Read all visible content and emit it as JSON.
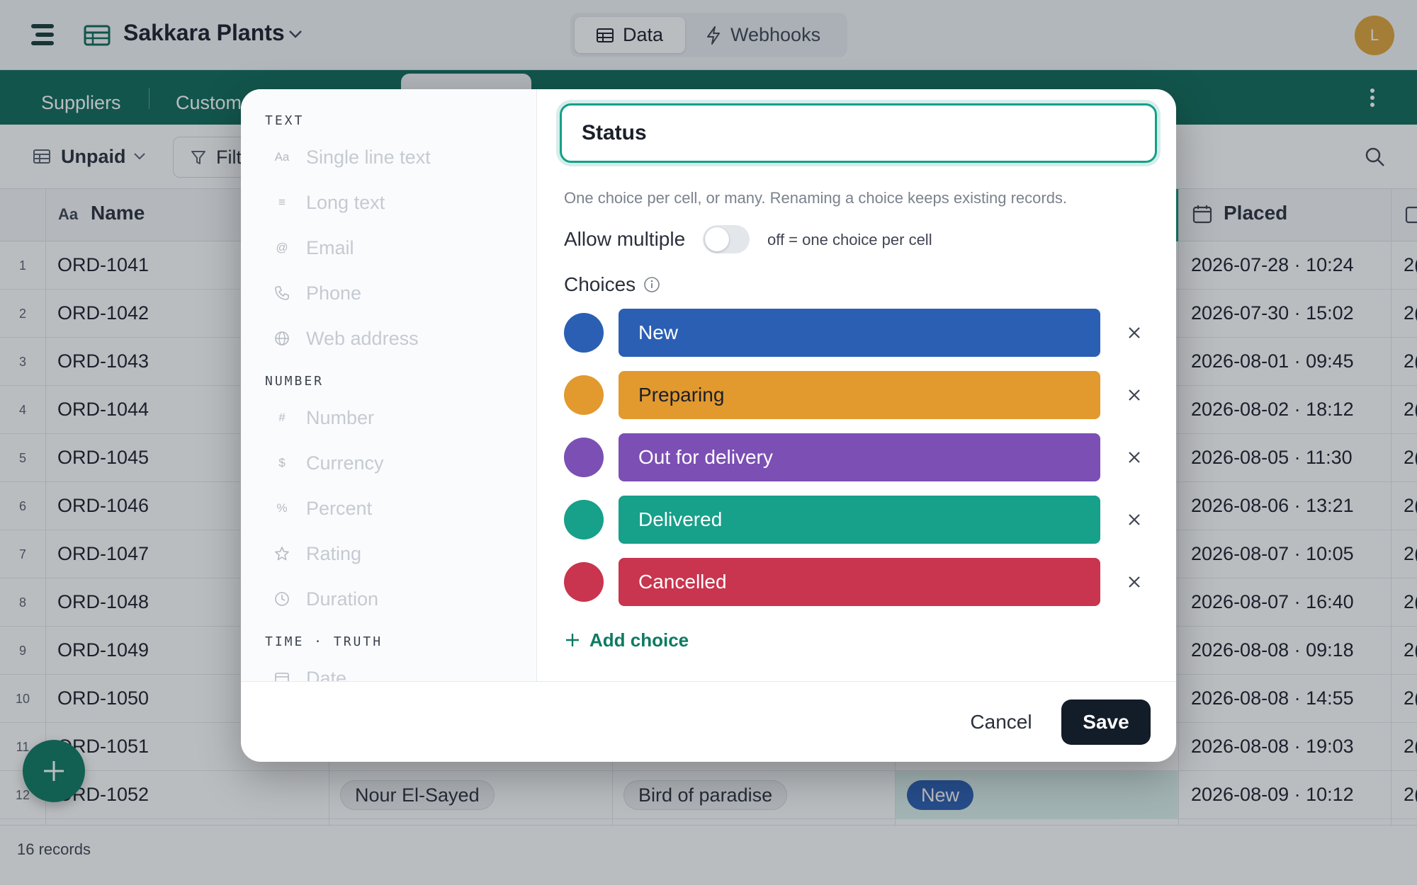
{
  "app": {
    "title": "Sakkara Plants",
    "avatar_initial": "L"
  },
  "modes": [
    {
      "label": "Data",
      "active": true
    },
    {
      "label": "Webhooks",
      "active": false
    }
  ],
  "tables": [
    "Suppliers",
    "Custom"
  ],
  "view": {
    "name": "Unpaid",
    "filter_label": "Filt"
  },
  "columns": {
    "name": "Name",
    "placed": "Placed"
  },
  "rows": [
    {
      "num": "1",
      "name": "ORD-1041",
      "placed": "2026-07-28 · 10:24"
    },
    {
      "num": "2",
      "name": "ORD-1042",
      "placed": "2026-07-30 · 15:02"
    },
    {
      "num": "3",
      "name": "ORD-1043",
      "placed": "2026-08-01 · 09:45"
    },
    {
      "num": "4",
      "name": "ORD-1044",
      "placed": "2026-08-02 · 18:12"
    },
    {
      "num": "5",
      "name": "ORD-1045",
      "placed": "2026-08-05 · 11:30"
    },
    {
      "num": "6",
      "name": "ORD-1046",
      "placed": "2026-08-06 · 13:21"
    },
    {
      "num": "7",
      "name": "ORD-1047",
      "placed": "2026-08-07 · 10:05"
    },
    {
      "num": "8",
      "name": "ORD-1048",
      "placed": "2026-08-07 · 16:40"
    },
    {
      "num": "9",
      "name": "ORD-1049",
      "placed": "2026-08-08 · 09:18"
    },
    {
      "num": "10",
      "name": "ORD-1050",
      "placed": "2026-08-08 · 14:55"
    },
    {
      "num": "11",
      "name": "ORD-1051",
      "placed": "2026-08-08 · 19:03"
    },
    {
      "num": "12",
      "name": "ORD-1052",
      "placed": "2026-08-09 · 10:12",
      "customer": "Nour El-Sayed",
      "plant": "Bird of paradise",
      "status": "New"
    }
  ],
  "truncated_cell": "2(",
  "footer": {
    "records": "16 records"
  },
  "field_editor": {
    "sections": [
      {
        "title": "TEXT",
        "types": [
          {
            "icon": "Aa",
            "label": "Single line text"
          },
          {
            "icon": "≡",
            "label": "Long text"
          },
          {
            "icon": "@",
            "label": "Email"
          },
          {
            "icon": "phone",
            "label": "Phone"
          },
          {
            "icon": "globe",
            "label": "Web address"
          }
        ]
      },
      {
        "title": "NUMBER",
        "types": [
          {
            "icon": "#",
            "label": "Number"
          },
          {
            "icon": "$",
            "label": "Currency"
          },
          {
            "icon": "%",
            "label": "Percent"
          },
          {
            "icon": "star",
            "label": "Rating"
          },
          {
            "icon": "clock",
            "label": "Duration"
          }
        ]
      },
      {
        "title": "TIME · TRUTH",
        "types": [
          {
            "icon": "calendar",
            "label": "Date"
          }
        ]
      }
    ],
    "field_name": "Status",
    "help": "One choice per cell, or many. Renaming a choice keeps existing records.",
    "allow_multiple": {
      "label": "Allow multiple",
      "value": false,
      "hint": "off = one choice per cell"
    },
    "choices_label": "Choices",
    "choices": [
      {
        "label": "New",
        "color": "#2b5fb4"
      },
      {
        "label": "Preparing",
        "color": "#e2992e"
      },
      {
        "label": "Out for delivery",
        "color": "#7c4fb4"
      },
      {
        "label": "Delivered",
        "color": "#17a08a"
      },
      {
        "label": "Cancelled",
        "color": "#c9344e"
      }
    ],
    "add_choice": "Add choice",
    "cancel": "Cancel",
    "save": "Save"
  }
}
